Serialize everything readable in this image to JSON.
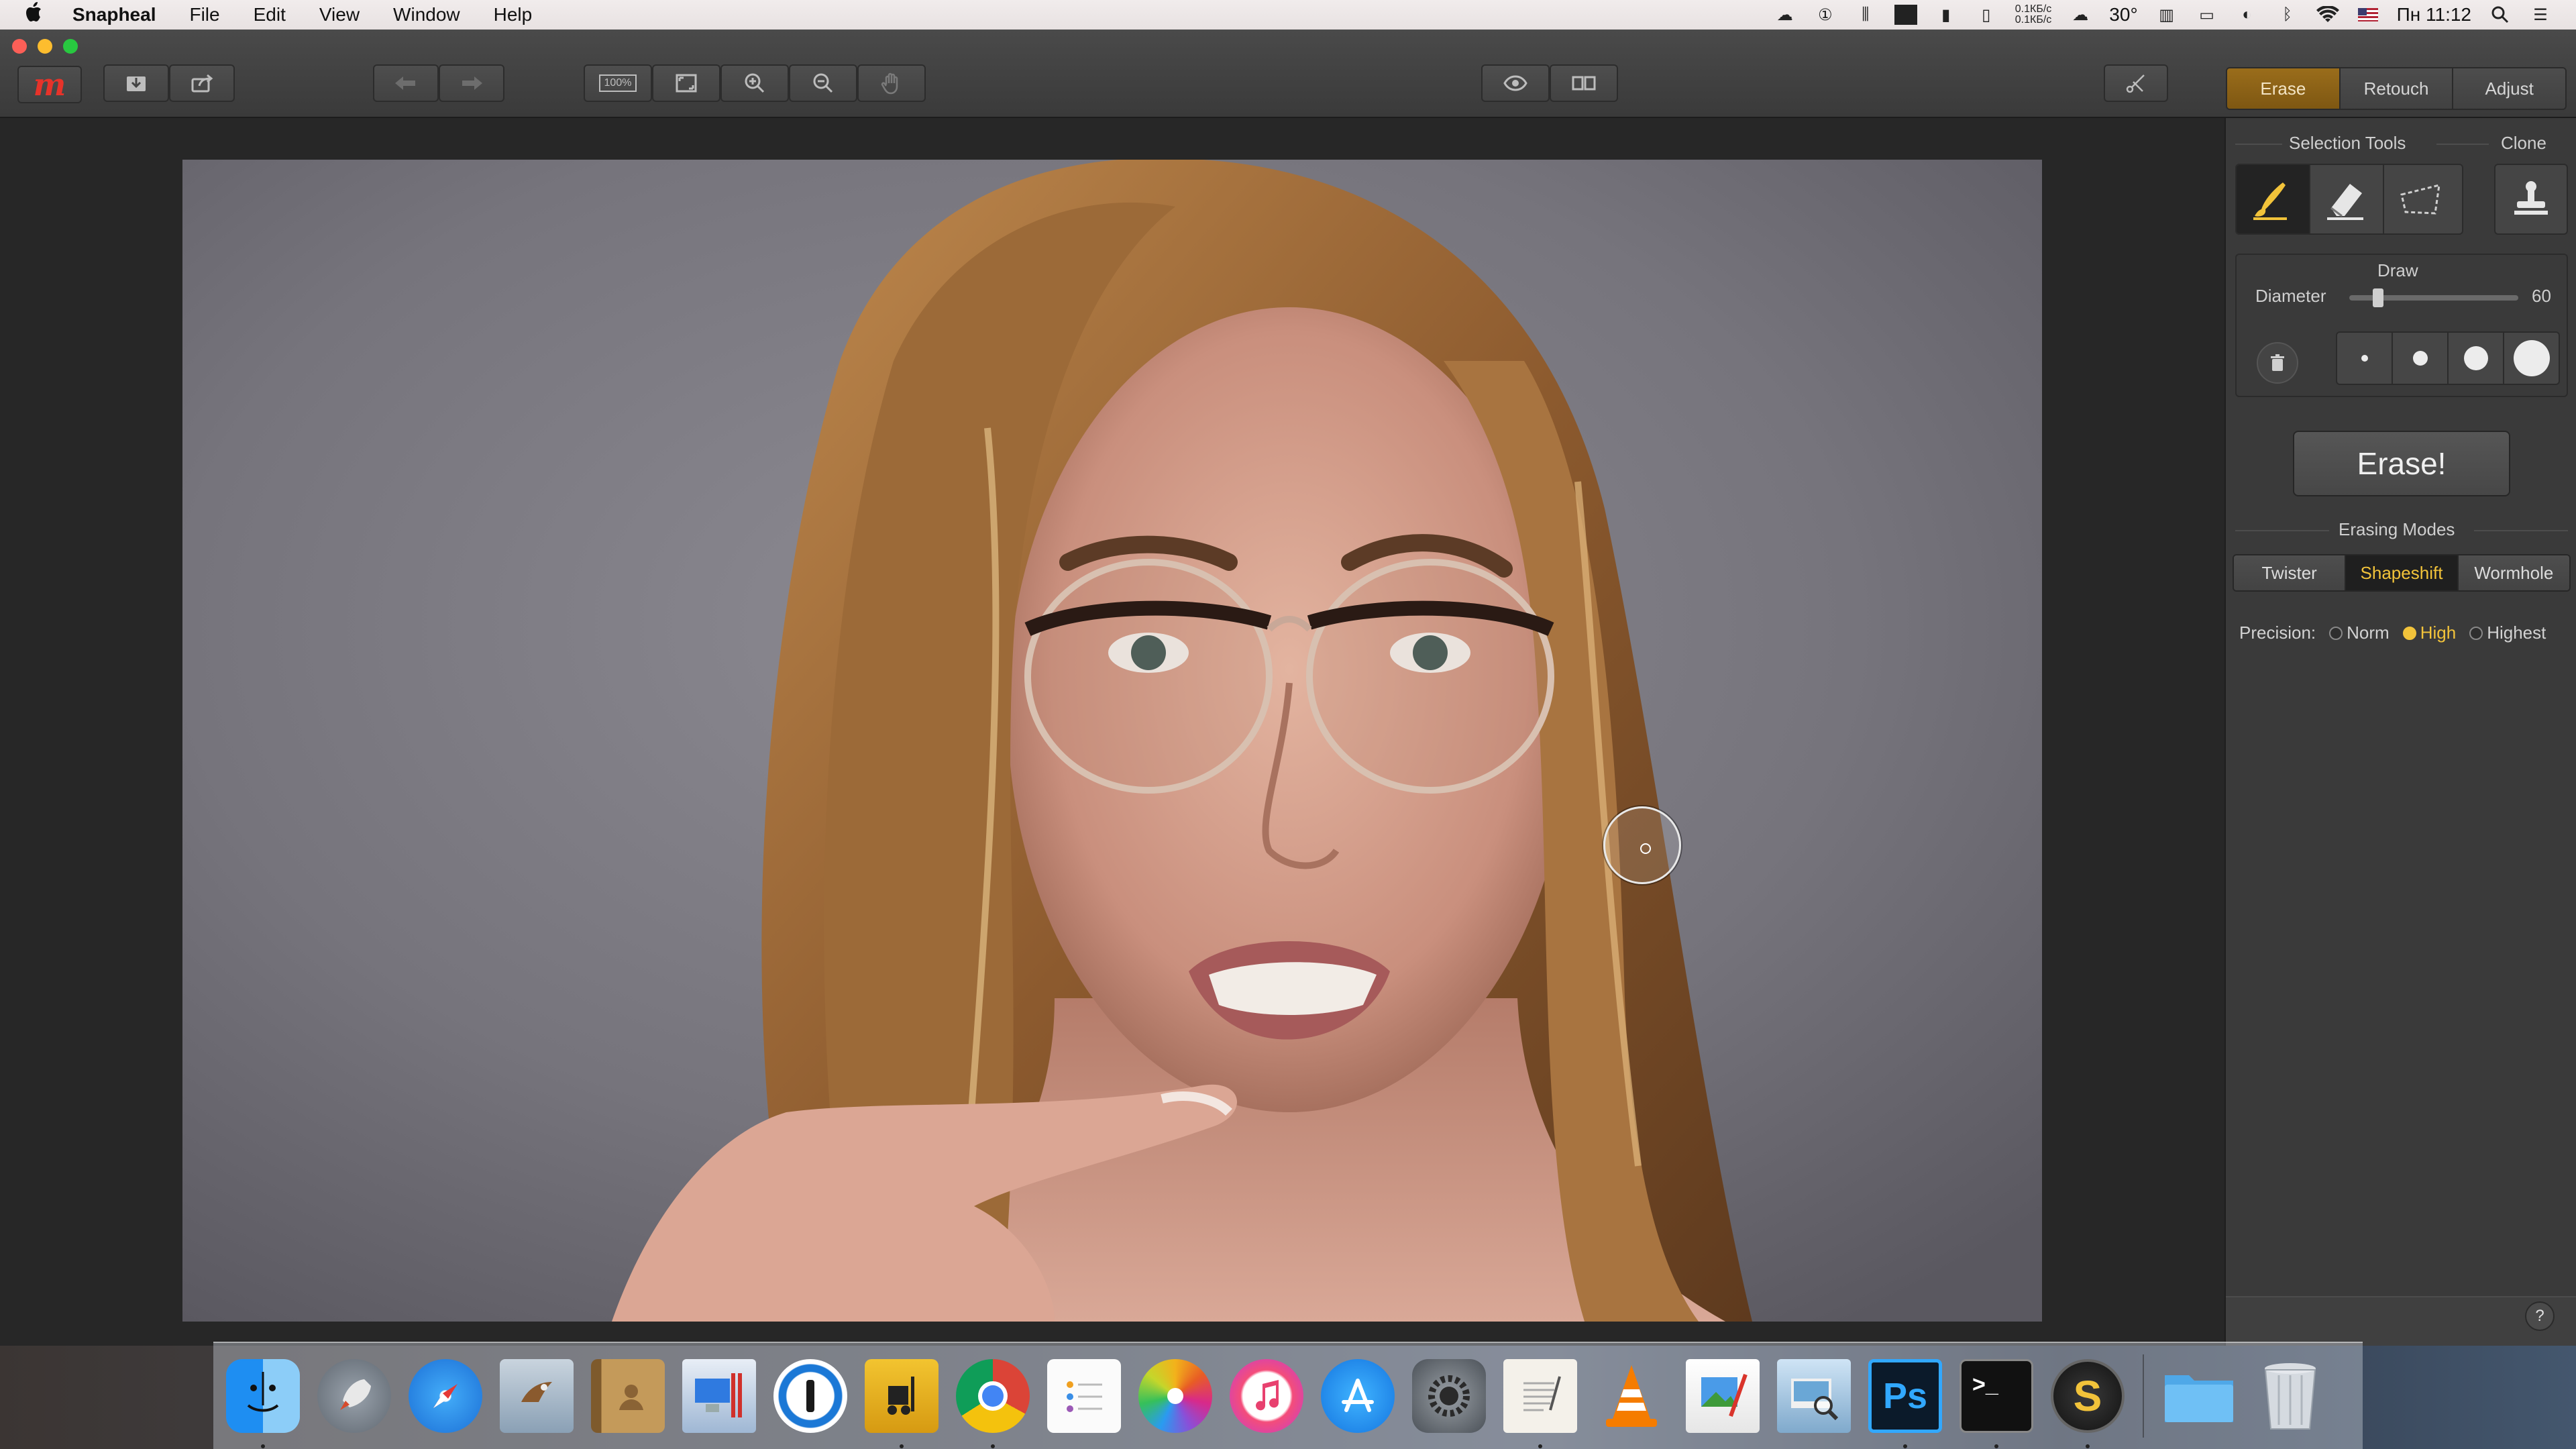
{
  "menubar": {
    "apple": "",
    "app_name": "Snapheal",
    "menus": [
      "File",
      "Edit",
      "View",
      "Window",
      "Help"
    ],
    "net_up": "0.1КБ/с",
    "net_down": "0.1КБ/с",
    "temperature": "30°",
    "clock": "Пн 11:12"
  },
  "toolbar": {
    "zoom_100_label": "100%"
  },
  "mode_tabs": [
    {
      "label": "Erase",
      "active": true
    },
    {
      "label": "Retouch",
      "active": false
    },
    {
      "label": "Adjust",
      "active": false
    }
  ],
  "panel": {
    "selection_tools_label": "Selection Tools",
    "clone_label": "Clone",
    "draw_label": "Draw",
    "diameter_label": "Diameter",
    "diameter_value": "60",
    "diameter_fraction": 0.15,
    "erase_button": "Erase!",
    "erasing_modes_label": "Erasing Modes",
    "erasing_modes": [
      {
        "label": "Twister",
        "active": false
      },
      {
        "label": "Shapeshift",
        "active": true
      },
      {
        "label": "Wormhole",
        "active": false
      }
    ],
    "precision_label": "Precision:",
    "precision_options": [
      {
        "label": "Norm",
        "selected": false
      },
      {
        "label": "High",
        "selected": true
      },
      {
        "label": "Highest",
        "selected": false
      }
    ],
    "help_label": "?"
  },
  "dock": {
    "apps": [
      "Finder",
      "Launchpad",
      "Safari",
      "Mail",
      "Contacts",
      "Parallels",
      "1Password",
      "Transmit",
      "Chrome",
      "Reminders",
      "Photos",
      "iTunes",
      "App Store",
      "System Preferences",
      "TextEdit",
      "VLC",
      "Pixelmator",
      "Preview",
      "Photoshop",
      "Terminal",
      "Sketch",
      "Downloads",
      "Trash"
    ],
    "photoshop_label": "Ps",
    "terminal_label": ">_",
    "sketch_label": "S"
  },
  "colors": {
    "accent_orange": "#9a6d1b",
    "highlight_yellow": "#f2c33a",
    "logo_red": "#e7332a"
  }
}
